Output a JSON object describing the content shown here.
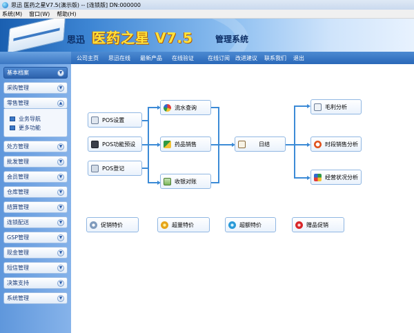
{
  "window": {
    "title": "思迅 医药之星V7.5(演示版) -- [连锁版] DN:000000"
  },
  "menu": [
    "系统(M)",
    "窗口(W)",
    "帮助(H)"
  ],
  "banner": {
    "brand_part1": "思迅",
    "brand_part2": "医药之星 V7.5",
    "brand_part3": "管理系统"
  },
  "nav": [
    "公司主页",
    "思迅在线",
    "最新产品",
    "在线验证",
    "在线订阅",
    "改进建议",
    "联系我们",
    "退出"
  ],
  "sidebar": {
    "items": [
      {
        "label": "基本档案",
        "state": "active"
      },
      {
        "label": "采购管理"
      },
      {
        "label": "零售管理",
        "expanded": true,
        "sub": [
          "业务导航",
          "更多功能"
        ]
      },
      {
        "label": "处方管理"
      },
      {
        "label": "批发管理"
      },
      {
        "label": "会员管理"
      },
      {
        "label": "仓库管理"
      },
      {
        "label": "结算管理"
      },
      {
        "label": "连锁配送"
      },
      {
        "label": "GSP管理"
      },
      {
        "label": "现金管理"
      },
      {
        "label": "短信管理"
      },
      {
        "label": "决策支持"
      },
      {
        "label": "系统管理"
      }
    ]
  },
  "flow": {
    "pos_setup": "POS设置",
    "pos_keys": "POS功能预设",
    "pos_login": "POS登记",
    "flow_query": "流水查询",
    "drug_sales": "药品销售",
    "cash_reconcile": "收银对账",
    "daily_close": "日结",
    "gross_profit": "毛利分析",
    "period_sales": "时段销售分析",
    "business_status": "经营状况分析"
  },
  "promos": [
    "促销特价",
    "超量特价",
    "超额特价",
    "赠品促销"
  ]
}
